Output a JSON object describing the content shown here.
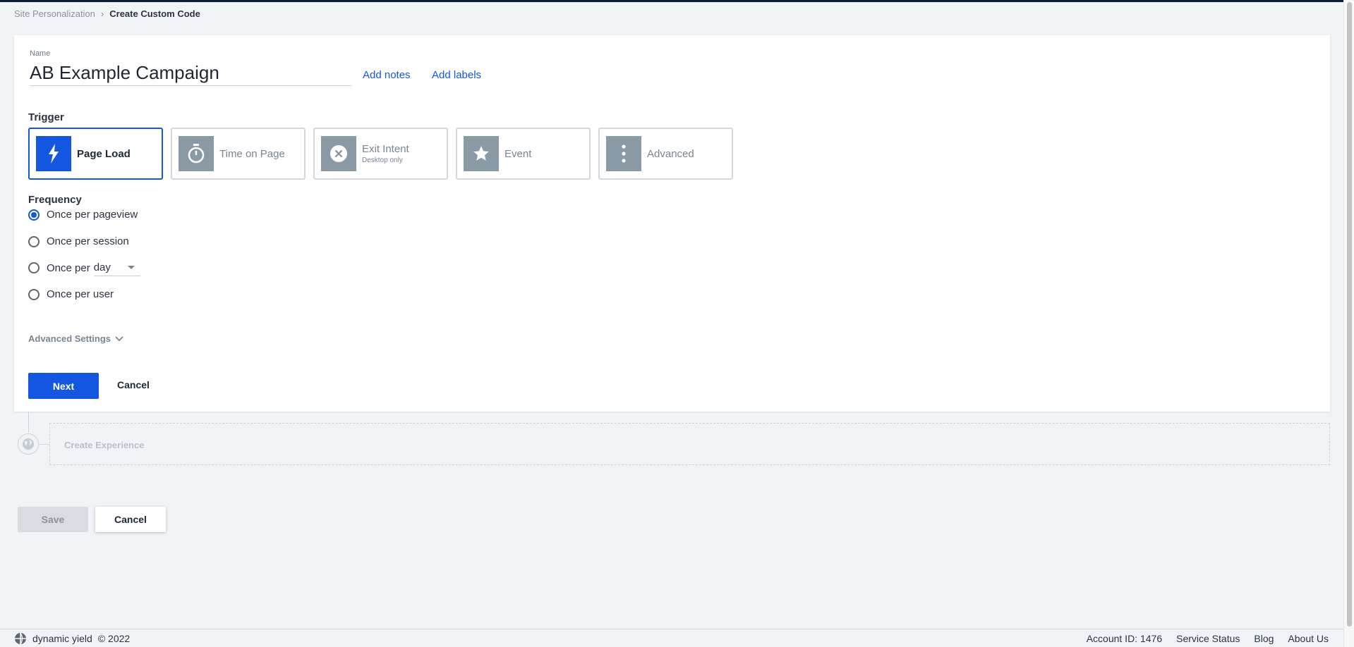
{
  "breadcrumb": {
    "parent": "Site Personalization",
    "separator": "›",
    "current": "Create Custom Code"
  },
  "form": {
    "name_label": "Name",
    "name_value": "AB Example Campaign",
    "add_notes": "Add notes",
    "add_labels": "Add labels",
    "trigger_title": "Trigger",
    "triggers": [
      {
        "label": "Page Load",
        "sub": "",
        "icon": "lightning-icon",
        "selected": true
      },
      {
        "label": "Time on Page",
        "sub": "",
        "icon": "stopwatch-icon",
        "selected": false
      },
      {
        "label": "Exit Intent",
        "sub": "Desktop only",
        "icon": "exit-x-icon",
        "selected": false
      },
      {
        "label": "Event",
        "sub": "",
        "icon": "star-icon",
        "selected": false
      },
      {
        "label": "Advanced",
        "sub": "",
        "icon": "more-vertical-icon",
        "selected": false
      }
    ],
    "frequency_title": "Frequency",
    "frequency_options": [
      {
        "label": "Once per pageview",
        "checked": true
      },
      {
        "label": "Once per session",
        "checked": false
      },
      {
        "label": "Once per",
        "checked": false,
        "select_value": "day"
      },
      {
        "label": "Once per user",
        "checked": false
      }
    ],
    "advanced_settings": "Advanced Settings",
    "next": "Next",
    "cancel": "Cancel"
  },
  "experience": {
    "label": "Create Experience"
  },
  "actions": {
    "save": "Save",
    "cancel": "Cancel"
  },
  "footer": {
    "brand": "dynamic yield",
    "copyright": "©  2022",
    "account": "Account ID: 1476",
    "links": [
      "Service Status",
      "Blog",
      "About Us"
    ]
  },
  "colors": {
    "accent": "#1456e0",
    "icon_gray": "#8a9aa5",
    "background": "#f1f4f7"
  }
}
